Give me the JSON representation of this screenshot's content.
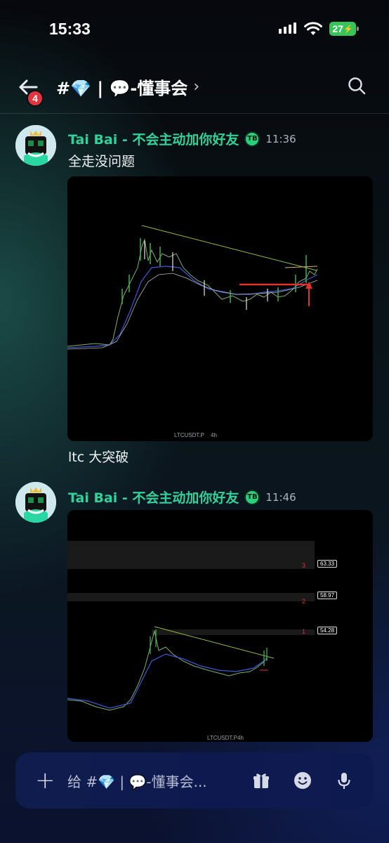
{
  "status_bar": {
    "time": "15:33",
    "battery": "27"
  },
  "header": {
    "back_badge": "4",
    "channel_title": "#💎 | 💬-懂事会"
  },
  "messages": [
    {
      "author": "Tai Bai - 不会主动加你好友",
      "role_icon": "TB",
      "timestamp": "11:36",
      "text": "全走没问题",
      "chart": {
        "symbol_label": "LTCUSDT.P",
        "interval_label": "4h"
      },
      "caption": "ltc 大突破"
    },
    {
      "author": "Tai Bai - 不会主动加你好友",
      "role_icon": "TB",
      "timestamp": "11:46",
      "chart": {
        "symbol_label": "LTCUSDT.P",
        "interval_label": "4h",
        "levels": [
          {
            "marker": "3",
            "price": "63.33"
          },
          {
            "marker": "2",
            "price": "58.97"
          },
          {
            "marker": "1",
            "price": "54.28"
          }
        ]
      }
    }
  ],
  "composer": {
    "placeholder": "给 #💎 | 💬-懂事会..."
  },
  "icons": {
    "back": "arrow-left-icon",
    "search": "search-icon",
    "add": "plus-icon",
    "gift": "gift-icon",
    "emoji": "emoji-icon",
    "mic": "microphone-icon"
  },
  "colors": {
    "author": "#2fd39a",
    "badge": "#e0343e",
    "battery": "#37c559",
    "composer": "#101b4e"
  }
}
